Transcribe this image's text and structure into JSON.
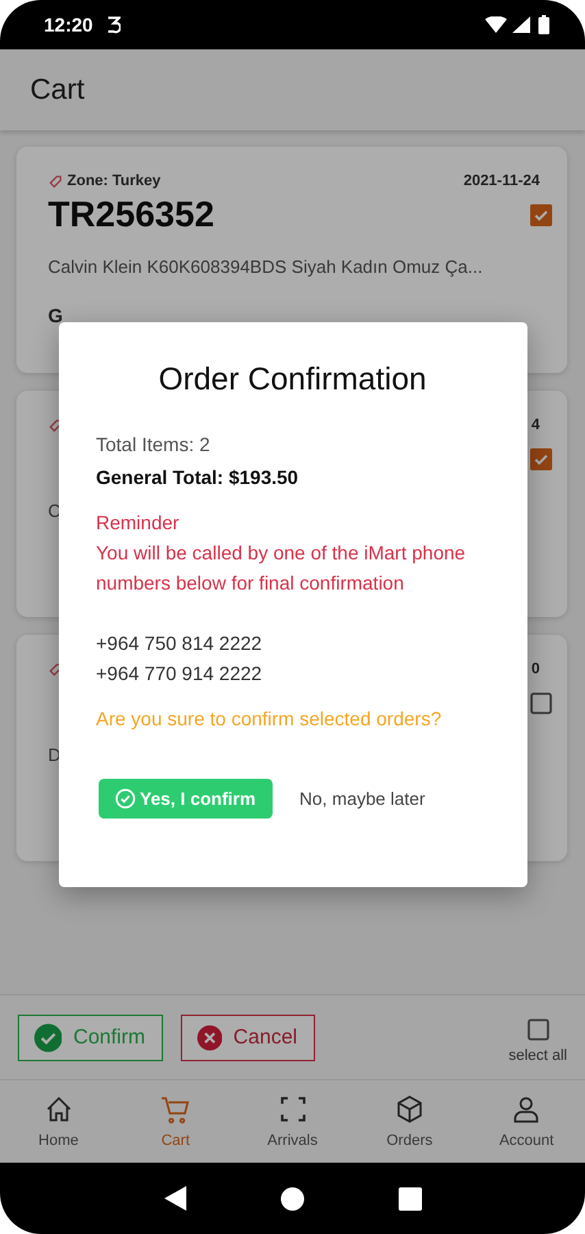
{
  "status_bar": {
    "time": "12:20"
  },
  "app_bar": {
    "title": "Cart"
  },
  "cards": [
    {
      "zone": "Zone: Turkey",
      "date": "2021-11-24",
      "code": "TR256352",
      "description": "Calvin Klein K60K608394BDS Siyah Kadın Omuz Ça...",
      "footer": "G",
      "checked": true
    },
    {
      "date": "4",
      "description": "C",
      "checked": true
    },
    {
      "date": "0",
      "description": "D",
      "checked": false
    }
  ],
  "dialog": {
    "title": "Order Confirmation",
    "total_items": "Total Items: 2",
    "general_total": "General Total: $193.50",
    "reminder_title": "Reminder",
    "reminder_text": "You will be called by one of the iMart phone numbers below for final confirmation",
    "phones": [
      "+964 750 814 2222",
      "+964 770 914 2222"
    ],
    "question": "Are you sure to confirm selected orders?",
    "confirm_button": "Yes, I confirm",
    "later_button": "No, maybe later"
  },
  "actions": {
    "confirm": "Confirm",
    "cancel": "Cancel",
    "select_all": {
      "label": "select all",
      "checked": false
    }
  },
  "nav": [
    {
      "kind": "home",
      "label": "Home",
      "selected": false
    },
    {
      "kind": "cart",
      "label": "Cart",
      "selected": true
    },
    {
      "kind": "scan",
      "label": "Arrivals",
      "selected": false
    },
    {
      "kind": "box",
      "label": "Orders",
      "selected": false
    },
    {
      "kind": "person",
      "label": "Account",
      "selected": false
    }
  ]
}
